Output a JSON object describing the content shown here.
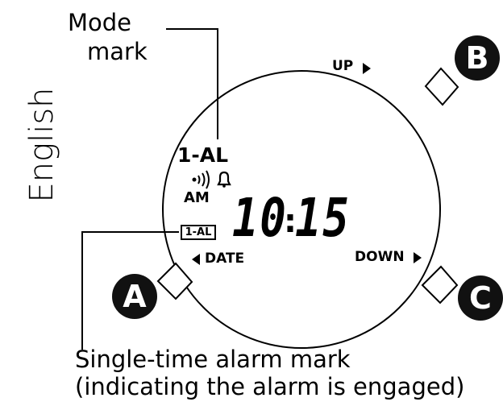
{
  "language_label": "English",
  "callouts": {
    "mode_mark": [
      "Mode",
      "mark"
    ],
    "single_alarm": [
      "Single-time alarm mark",
      "(indicating the alarm is engaged)"
    ]
  },
  "display": {
    "mode_code": "1-AL",
    "am_pm": "AM",
    "hours": "10",
    "minutes": "15",
    "single_alarm_indicator": "1-AL",
    "icons": [
      "signal-icon",
      "bell-icon"
    ]
  },
  "nav_labels": {
    "up": "UP",
    "date": "DATE",
    "down": "DOWN"
  },
  "buttons": {
    "a": "A",
    "b": "B",
    "c": "C"
  },
  "colors": {
    "ink": "#000000",
    "button_fill": "#111111",
    "button_text": "#ffffff"
  }
}
